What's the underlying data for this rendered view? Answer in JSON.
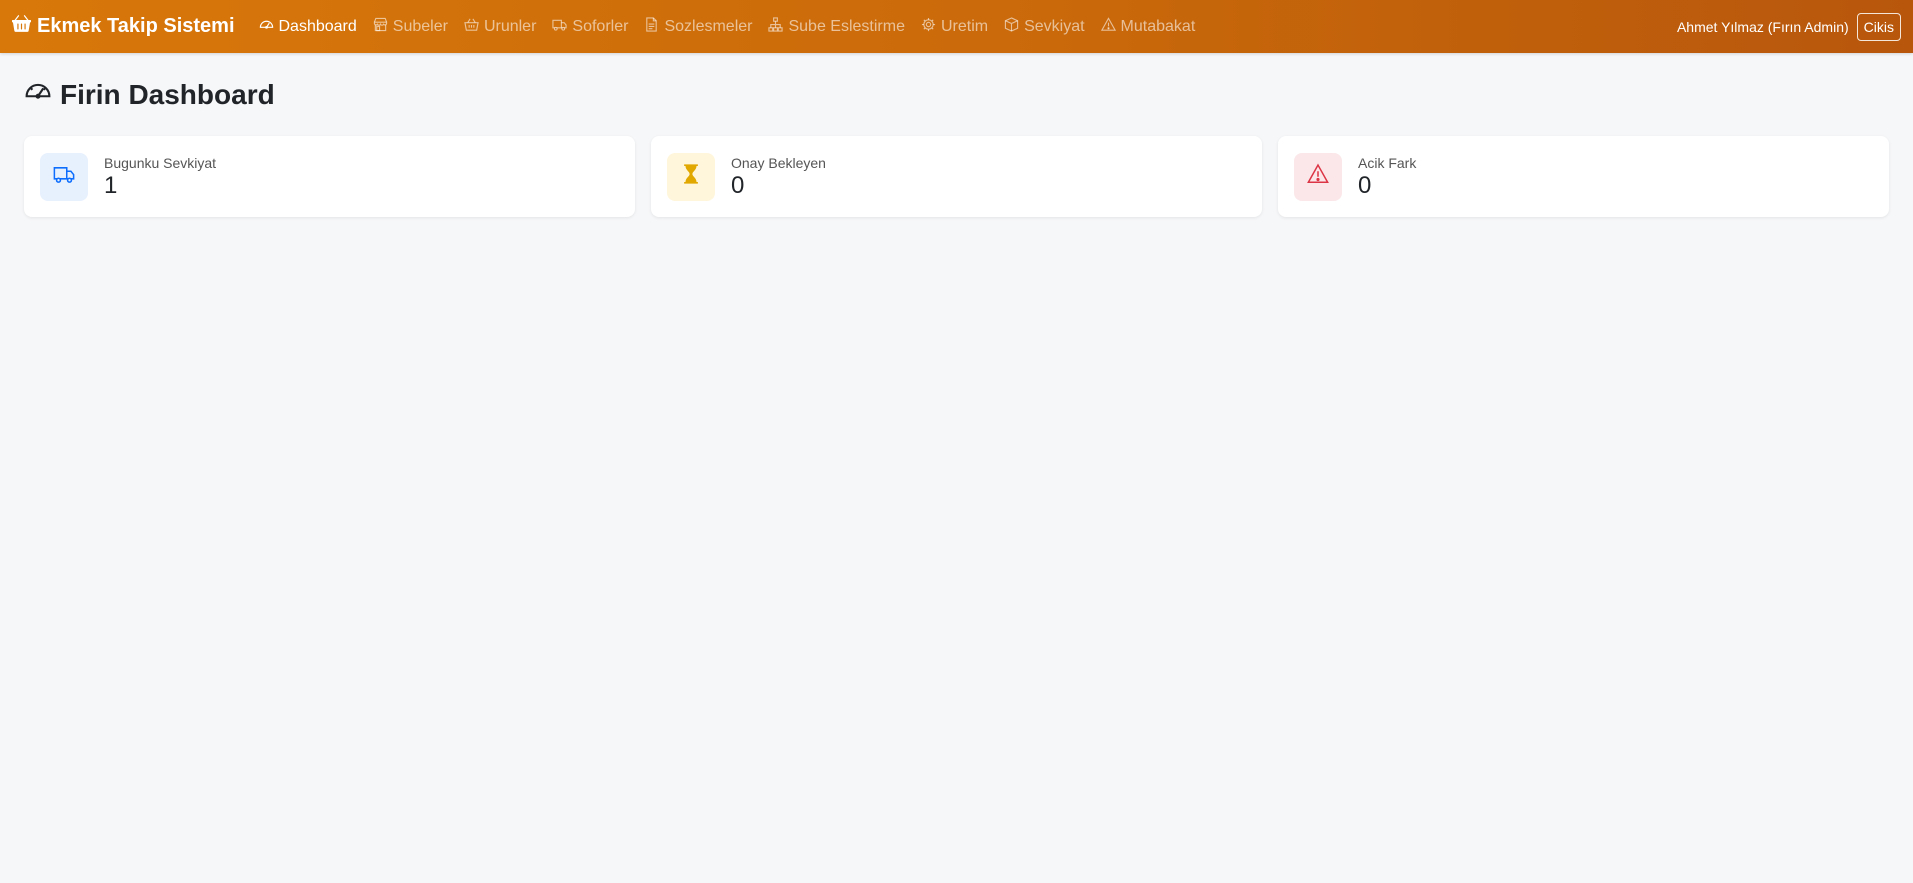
{
  "app": {
    "brand": "Ekmek Takip Sistemi",
    "brand_icon": "basket-icon"
  },
  "nav": {
    "items": [
      {
        "label": "Dashboard",
        "icon": "speedometer-icon",
        "active": true
      },
      {
        "label": "Subeler",
        "icon": "shop-icon"
      },
      {
        "label": "Urunler",
        "icon": "basket-icon"
      },
      {
        "label": "Soforler",
        "icon": "truck-icon"
      },
      {
        "label": "Sozlesmeler",
        "icon": "document-icon"
      },
      {
        "label": "Sube Eslestirme",
        "icon": "diagram-icon"
      },
      {
        "label": "Uretim",
        "icon": "gear-icon"
      },
      {
        "label": "Sevkiyat",
        "icon": "box-icon"
      },
      {
        "label": "Mutabakat",
        "icon": "warning-icon"
      }
    ],
    "user": "Ahmet Yılmaz (Fırın Admin)",
    "logout_label": "Cikis"
  },
  "page": {
    "title": "Firin Dashboard",
    "title_icon": "speedometer-icon"
  },
  "cards": [
    {
      "label": "Bugunku Sevkiyat",
      "value": "1",
      "icon": "truck-icon",
      "icon_color": "#0d6efd",
      "bg": "#e7f0fd"
    },
    {
      "label": "Onay Bekleyen",
      "value": "0",
      "icon": "hourglass-icon",
      "icon_color": "#e0a800",
      "bg": "#fff6dc"
    },
    {
      "label": "Acik Fark",
      "value": "0",
      "icon": "warning-icon",
      "icon_color": "#dc3545",
      "bg": "#fbe7e9"
    }
  ],
  "colors": {
    "navbar_start": "#d8780a",
    "navbar_end": "#b8570c",
    "background": "#f6f7f9"
  }
}
